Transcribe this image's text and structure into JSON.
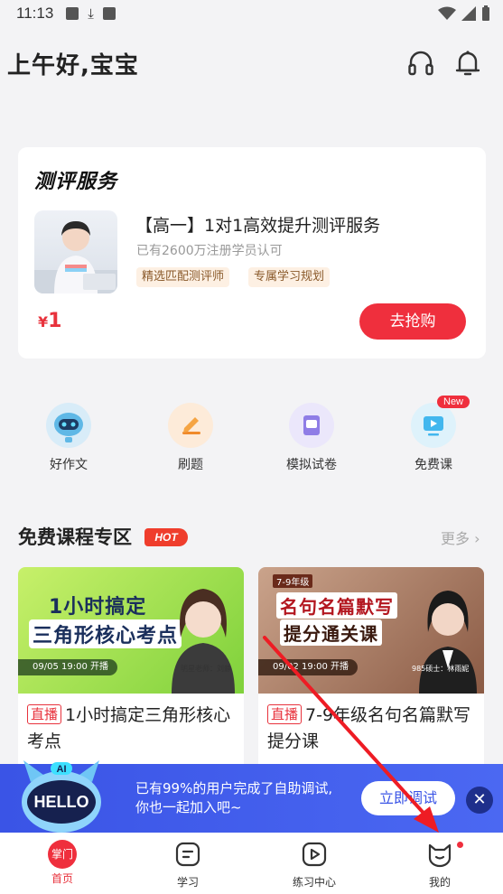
{
  "status_bar": {
    "time": "11:13"
  },
  "header": {
    "greeting": "上午好,宝宝",
    "headset_icon": "headset-icon",
    "bell_icon": "bell-icon"
  },
  "promo_card": {
    "title": "测评服务",
    "heading": "【高一】1对1高效提升测评服务",
    "subtitle": "已有2600万注册学员认可",
    "tags": [
      "精选匹配测评师",
      "专属学习规划"
    ],
    "price_symbol": "¥",
    "price_value": "1",
    "buy_label": "去抢购"
  },
  "quick_actions": [
    {
      "label": "好作文",
      "icon": "robot-icon"
    },
    {
      "label": "刷题",
      "icon": "pencil-icon"
    },
    {
      "label": "模拟试卷",
      "icon": "exam-paper-icon"
    },
    {
      "label": "免费课",
      "icon": "video-play-icon",
      "badge": "New"
    }
  ],
  "free_courses": {
    "title": "免费课程专区",
    "hot_badge": "HOT",
    "more_label": "更多",
    "courses": [
      {
        "banner_line1": "1小时搞定",
        "banner_line2": "三角形核心考点",
        "banner_date": "09/05 19:00 开播",
        "teacher": "明星老师：刘静",
        "live_tag": "直播",
        "title": "1小时搞定三角形核心考点"
      },
      {
        "grade_tag": "7-9年级",
        "banner_line1": "名句名篇默写",
        "banner_line2": "提分通关课",
        "banner_date": "09/02 19:00 开播",
        "teacher": "985硕士：林雨妮",
        "live_tag": "直播",
        "title": "7-9年级名句名篇默写提分课"
      }
    ]
  },
  "promo_banner": {
    "mascot_text": "HELLO",
    "mascot_badge": "AI",
    "line1": "已有99%的用户完成了自助调试,",
    "line2": "你也一起加入吧~",
    "button_label": "立即调试"
  },
  "tab_bar": {
    "tabs": [
      {
        "label": "首页",
        "icon_text": "掌门",
        "active": true
      },
      {
        "label": "学习",
        "icon": "study-icon"
      },
      {
        "label": "练习中心",
        "icon": "practice-play-icon"
      },
      {
        "label": "我的",
        "icon": "profile-cat-icon"
      }
    ]
  }
}
